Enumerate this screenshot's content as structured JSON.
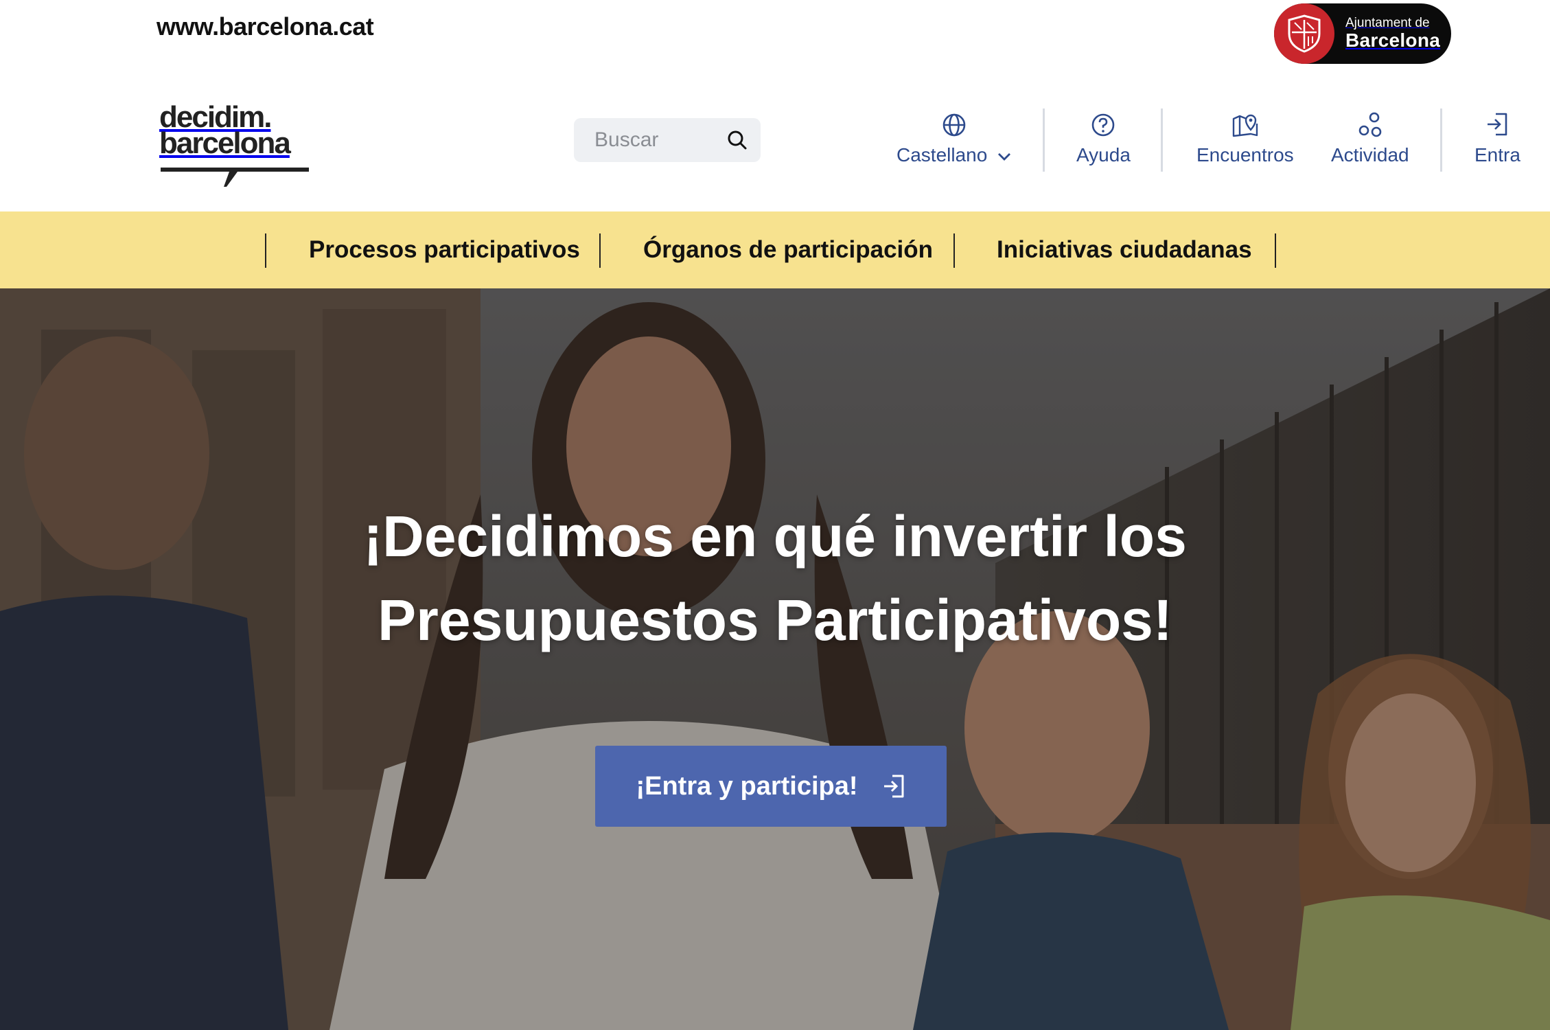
{
  "topbar": {
    "site_link": "www.barcelona.cat",
    "ajuntament_small": "Ajuntament de",
    "ajuntament_big": "Barcelona"
  },
  "header": {
    "logo_line1": "decidim.",
    "logo_line2": "barcelona",
    "search_placeholder": "Buscar",
    "nav": {
      "language": "Castellano",
      "help": "Ayuda",
      "meetings": "Encuentros",
      "activity": "Actividad",
      "login": "Entra"
    }
  },
  "categories": [
    "Procesos participativos",
    "Órganos de participación",
    "Iniciativas ciudadanas"
  ],
  "hero": {
    "title_line1": "¡Decidimos en qué invertir los",
    "title_line2": "Presupuestos Participativos!",
    "cta_label": "¡Entra y participa!"
  },
  "colors": {
    "nav_text": "#2d4a8c",
    "category_bar": "#f7e28f",
    "cta_background": "#4d66ae",
    "ajuntament_red": "#c9262c"
  },
  "icons": [
    "globe-icon",
    "chevron-down-icon",
    "help-circle-icon",
    "map-pin-icon",
    "activity-icon",
    "login-icon",
    "search-icon",
    "barcelona-seal-icon"
  ]
}
